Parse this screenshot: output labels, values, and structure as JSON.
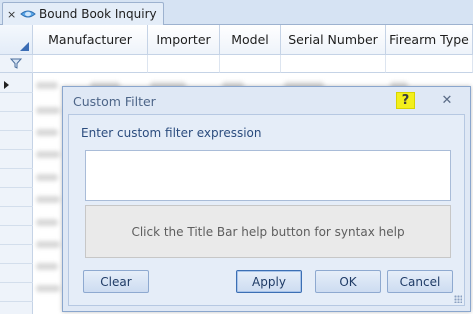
{
  "tab": {
    "close_glyph": "×",
    "label": "Bound Book Inquiry",
    "icon": "database-icon"
  },
  "grid": {
    "columns": [
      "Manufacturer",
      "Importer",
      "Model",
      "Serial Number",
      "Firearm Type"
    ],
    "filter_icon": "funnel-icon"
  },
  "dialog": {
    "title": "Custom Filter",
    "help_label": "?",
    "close_glyph": "✕",
    "prompt": "Enter custom filter expression",
    "expression_value": "",
    "hint": "Click the Title Bar help button for syntax help",
    "buttons": {
      "clear": "Clear",
      "apply": "Apply",
      "ok": "OK",
      "cancel": "Cancel"
    }
  },
  "colors": {
    "accent": "#3b6db5",
    "help_highlight": "#f3ef1d",
    "dialog_bg": "#dfe8f5"
  }
}
